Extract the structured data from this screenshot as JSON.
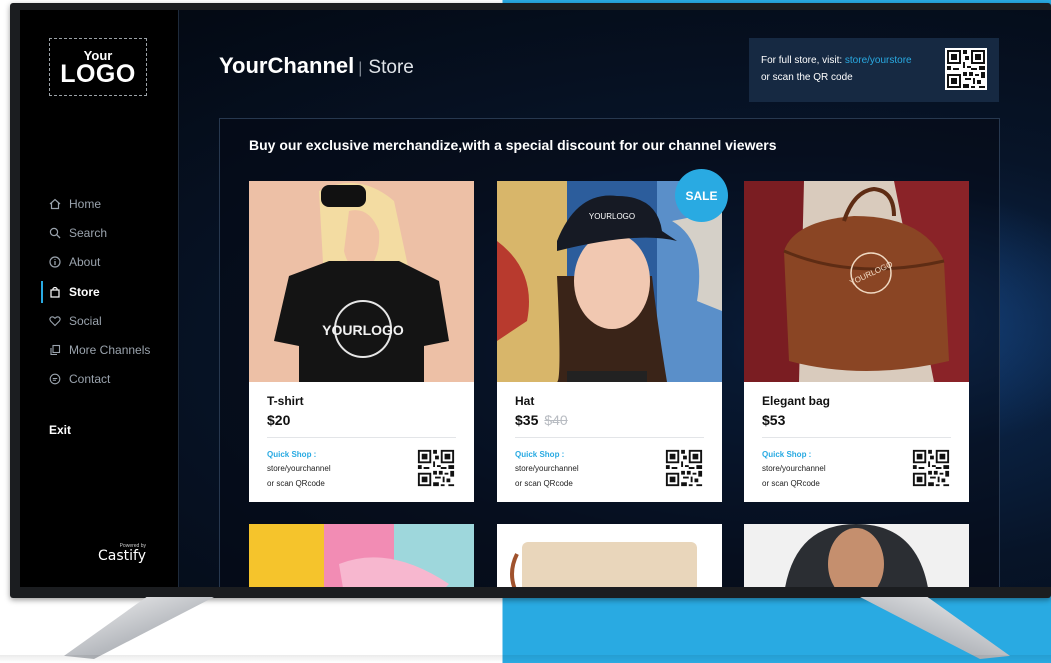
{
  "sidebar": {
    "logo": {
      "small": "Your",
      "big": "LOGO"
    },
    "items": [
      {
        "label": "Home",
        "icon": "home-icon"
      },
      {
        "label": "Search",
        "icon": "search-icon"
      },
      {
        "label": "About",
        "icon": "info-icon"
      },
      {
        "label": "Store",
        "icon": "bag-icon",
        "active": true
      },
      {
        "label": "Social",
        "icon": "heart-icon"
      },
      {
        "label": "More Channels",
        "icon": "copy-icon"
      },
      {
        "label": "Contact",
        "icon": "chat-icon"
      }
    ],
    "exit_label": "Exit",
    "powered": {
      "prefix": "Powered by",
      "brand": "Castify"
    }
  },
  "header": {
    "channel": "YourChannel",
    "separator": "|",
    "section": "Store",
    "visit_prefix": "For full store, visit: ",
    "visit_link": "store/yourstore",
    "visit_scan": "or scan the QR code"
  },
  "main": {
    "headline": "Buy our exclusive merchandize,with a special discount for our channel viewers",
    "sale_badge": "SALE",
    "products": [
      {
        "name": "T-shirt",
        "price": "$20",
        "old_price": "",
        "quick_shop": "Quick Shop :",
        "url": "store/yourchannel",
        "scan": "or scan QRcode",
        "logo_text": "YOURLOGO"
      },
      {
        "name": "Hat",
        "price": "$35",
        "old_price": "$40",
        "quick_shop": "Quick Shop :",
        "url": "store/yourchannel",
        "scan": "or scan QRcode",
        "logo_text": "YOURLOGO"
      },
      {
        "name": "Elegant bag",
        "price": "$53",
        "old_price": "",
        "quick_shop": "Quick Shop :",
        "url": "store/yourchannel",
        "scan": "or scan QRcode",
        "logo_text": "YOURLOGO"
      }
    ]
  },
  "colors": {
    "accent": "#29aae2",
    "screen_bg": "#03070f",
    "card_bg": "#ffffff"
  }
}
